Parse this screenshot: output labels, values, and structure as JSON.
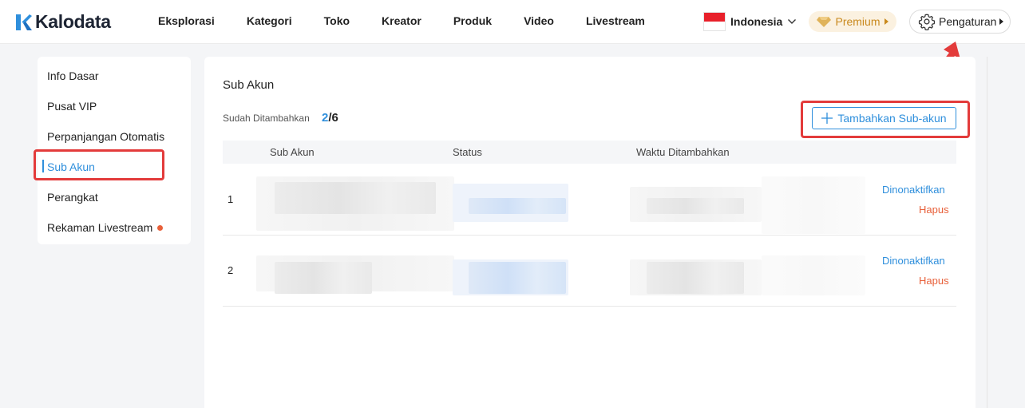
{
  "brand": {
    "name": "Kalodata"
  },
  "nav": [
    "Eksplorasi",
    "Kategori",
    "Toko",
    "Kreator",
    "Produk",
    "Video",
    "Livestream"
  ],
  "country": {
    "name": "Indonesia"
  },
  "premium": {
    "label": "Premium"
  },
  "settings": {
    "label": "Pengaturan"
  },
  "sidebar": {
    "items": [
      {
        "label": "Info Dasar"
      },
      {
        "label": "Pusat VIP"
      },
      {
        "label": "Perpanjangan Otomatis"
      },
      {
        "label": "Sub Akun",
        "active": true
      },
      {
        "label": "Perangkat"
      },
      {
        "label": "Rekaman Livestream",
        "dot": true
      }
    ]
  },
  "main": {
    "title": "Sub Akun",
    "count_label": "Sudah Ditambahkan",
    "count_current": "2",
    "count_total": "/6",
    "add_button": "Tambahkan Sub-akun",
    "columns": [
      "Sub Akun",
      "Status",
      "Waktu Ditambahkan"
    ],
    "rows": [
      {
        "num": "1",
        "deactivate": "Dinonaktifkan",
        "delete": "Hapus"
      },
      {
        "num": "2",
        "deactivate": "Dinonaktifkan",
        "delete": "Hapus"
      }
    ]
  },
  "colors": {
    "accent": "#2f8fdc",
    "danger": "#e8603a",
    "premium": "#c9891d",
    "highlight": "#e33b3b"
  }
}
